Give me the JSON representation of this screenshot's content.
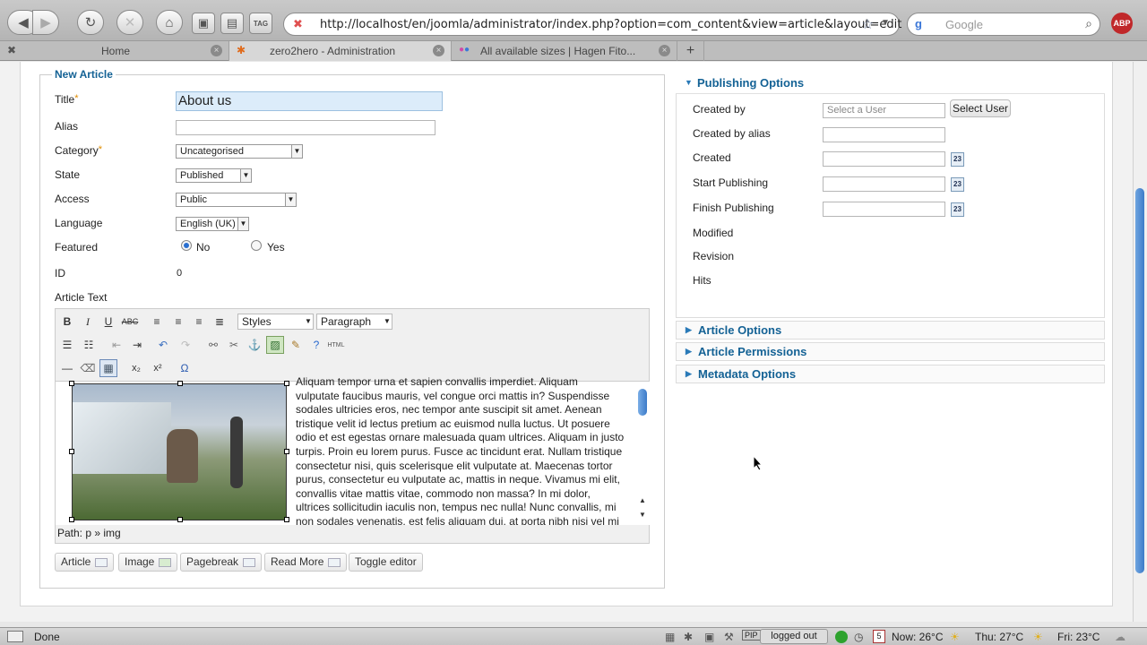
{
  "browser": {
    "url": "http://localhost/en/joomla/administrator/index.php?option=com_content&view=article&layout=edit",
    "search_placeholder": "Google",
    "tabs": [
      {
        "label": "Home"
      },
      {
        "label": "zero2hero - Administration"
      },
      {
        "label": "All available sizes | Hagen Fito..."
      }
    ],
    "new_tab_label": "+"
  },
  "article": {
    "legend": "New Article",
    "title_label": "Title",
    "title_value": "About us",
    "alias_label": "Alias",
    "alias_value": "",
    "category_label": "Category",
    "category_value": "Uncategorised",
    "state_label": "State",
    "state_value": "Published",
    "access_label": "Access",
    "access_value": "Public",
    "language_label": "Language",
    "language_value": "English (UK)",
    "featured_label": "Featured",
    "featured_no": "No",
    "featured_yes": "Yes",
    "featured_selected": "No",
    "id_label": "ID",
    "id_value": "0",
    "article_text_label": "Article Text",
    "required_mark": "*"
  },
  "editor": {
    "styles_select": "Styles",
    "format_select": "Paragraph",
    "html_button": "HTML",
    "text_lines": [
      "Aliquam tempor urna et sapien convallis imperdiet. Aliquam",
      "vulputate faucibus mauris, vel congue orci mattis in? Suspendisse",
      "sodales ultricies eros, nec tempor ante suscipit sit amet. Aenean",
      "tristique velit id lectus pretium ac euismod nulla luctus. Ut posuere",
      "odio et est egestas ornare malesuada quam ultrices. Aliquam in justo",
      "turpis. Proin eu lorem purus. Fusce ac tincidunt erat. Nullam tristique",
      "consectetur nisi, quis scelerisque elit vulputate at. Maecenas tortor",
      "purus, consectetur eu vulputate ac, mattis in neque. Vivamus mi elit,",
      "convallis vitae mattis vitae, commodo non massa? In mi dolor,",
      "ultrices sollicitudin iaculis non, tempus nec nulla! Nunc convallis, mi",
      "non sodales venenatis, est felis aliquam dui, at porta nibh nisi vel mi"
    ],
    "path": "Path: p » img",
    "buttons": [
      "Article",
      "Image",
      "Pagebreak",
      "Read More",
      "Toggle editor"
    ]
  },
  "publishing": {
    "title": "Publishing Options",
    "created_by_label": "Created by",
    "created_by_placeholder": "Select a User",
    "select_user_button": "Select User",
    "created_by_alias_label": "Created by alias",
    "created_label": "Created",
    "start_publishing_label": "Start Publishing",
    "finish_publishing_label": "Finish Publishing",
    "modified_label": "Modified",
    "revision_label": "Revision",
    "hits_label": "Hits",
    "calendar_glyph": "23"
  },
  "panels": {
    "article_options": "Article Options",
    "article_permissions": "Article Permissions",
    "metadata_options": "Metadata Options"
  },
  "status": {
    "left": "Done",
    "logged_out": "logged out",
    "pip": "PIP",
    "day_number": "5",
    "weather_now": "Now: 26°C",
    "weather_thu": "Thu: 27°C",
    "weather_fri": "Fri: 23°C"
  },
  "colors": {
    "accent": "#146295",
    "required": "#e08c00",
    "title_field_bg": "#dcecfa"
  }
}
